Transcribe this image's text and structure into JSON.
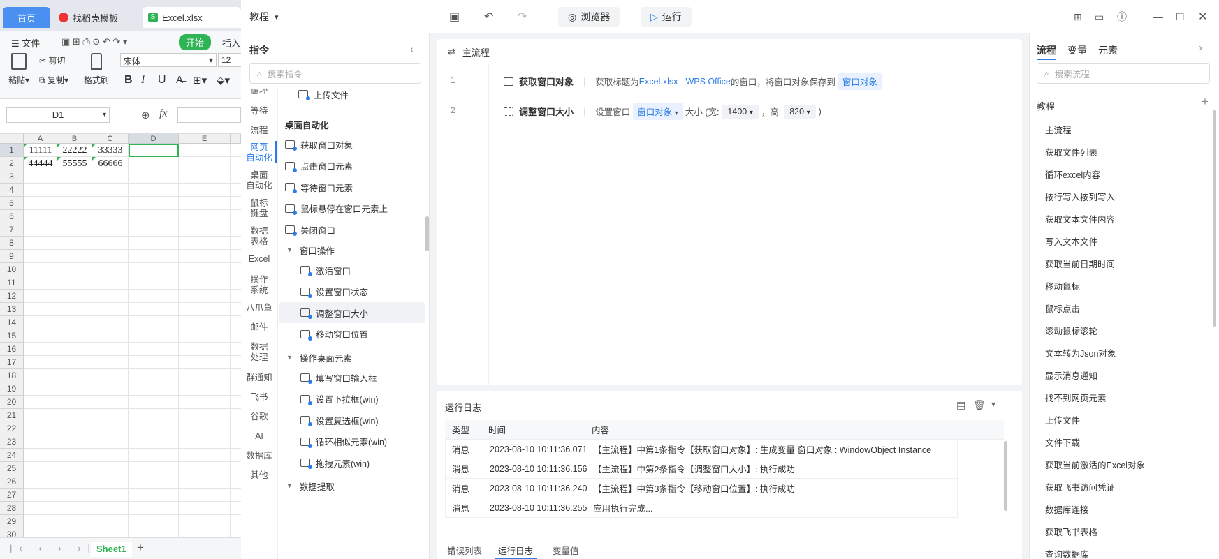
{
  "wps": {
    "tabs": {
      "home": "首页",
      "template": "找稻壳模板",
      "file": "Excel.xlsx"
    },
    "toolbar": {
      "file_menu": "文件",
      "start": "开始",
      "insert": "插入"
    },
    "ribbon": {
      "paste": "粘贴",
      "cut": "剪切",
      "copy": "复制",
      "format_painter": "格式刷",
      "font_name": "宋体",
      "font_size": "12"
    },
    "cell_ref": "D1",
    "fx": "fx",
    "columns": [
      "A",
      "B",
      "C",
      "D",
      "E"
    ],
    "rows": [
      "1",
      "2",
      "3",
      "4",
      "5",
      "6",
      "7",
      "8",
      "9",
      "10",
      "11",
      "12",
      "13",
      "14",
      "15",
      "16",
      "17",
      "18",
      "19",
      "20",
      "21",
      "22",
      "23",
      "24",
      "25",
      "26",
      "27",
      "28",
      "29",
      "30"
    ],
    "cells": [
      [
        "11111",
        "22222",
        "33333"
      ],
      [
        "44444",
        "55555",
        "66666"
      ]
    ],
    "sheet_tab": "Sheet1"
  },
  "app": {
    "project_title": "教程",
    "browser_label": "浏览器",
    "run_label": "运行",
    "cmd_panel": {
      "title": "指令",
      "search_placeholder": "搜索指令",
      "categories": [
        "循环",
        "等待",
        "流程",
        "网页自动化",
        "桌面自动化",
        "鼠标键盘",
        "数据表格",
        "Excel",
        "操作系统",
        "八爪鱼",
        "邮件",
        "数据处理",
        "群通知",
        "飞书",
        "谷歌",
        "AI",
        "数据库",
        "其他"
      ],
      "top_item": "上传文件",
      "section": "桌面自动化",
      "items": [
        "获取窗口对象",
        "点击窗口元素",
        "等待窗口元素",
        "鼠标悬停在窗口元素上",
        "关闭窗口"
      ],
      "group1": "窗口操作",
      "group1_items": [
        "激活窗口",
        "设置窗口状态",
        "调整窗口大小",
        "移动窗口位置"
      ],
      "group2": "操作桌面元素",
      "group2_items": [
        "填写窗口输入框",
        "设置下拉框(win)",
        "设置复选框(win)",
        "循环相似元素(win)",
        "拖拽元素(win)"
      ],
      "group3": "数据提取"
    },
    "main_tab": "主流程",
    "steps": [
      {
        "num": "1",
        "title": "获取窗口对象",
        "pre": "获取标题为",
        "link": "Excel.xlsx - WPS Office",
        "mid": "的窗口，将窗口对象保存到",
        "tag": "窗口对象"
      },
      {
        "num": "2",
        "title": "调整窗口大小",
        "pre": "设置窗口",
        "tag": "窗口对象",
        "size_label": "大小 (宽:",
        "width": "1400",
        "height_label": "，高:",
        "height": "820",
        "end": ")"
      }
    ],
    "log": {
      "title": "运行日志",
      "headers": [
        "类型",
        "时间",
        "内容"
      ],
      "rows": [
        {
          "type": "消息",
          "time": "2023-08-10 10:11:36.071",
          "content": "【主流程】中第1条指令【获取窗口对象】: 生成变量 窗口对象 : WindowObject Instance"
        },
        {
          "type": "消息",
          "time": "2023-08-10 10:11:36.156",
          "content": "【主流程】中第2条指令【调整窗口大小】: 执行成功"
        },
        {
          "type": "消息",
          "time": "2023-08-10 10:11:36.240",
          "content": "【主流程】中第3条指令【移动窗口位置】: 执行成功"
        },
        {
          "type": "消息",
          "time": "2023-08-10 10:11:36.255",
          "content": "应用执行完成..."
        }
      ],
      "bottom_tabs": [
        "错误列表",
        "运行日志",
        "变量值"
      ]
    },
    "right_panel": {
      "tabs": [
        "流程",
        "变量",
        "元素"
      ],
      "search_placeholder": "搜索流程",
      "group": "教程",
      "flows": [
        "主流程",
        "获取文件列表",
        "循环excel内容",
        "按行写入按列写入",
        "获取文本文件内容",
        "写入文本文件",
        "获取当前日期时间",
        "移动鼠标",
        "鼠标点击",
        "滚动鼠标滚轮",
        "文本转为Json对象",
        "显示消息通知",
        "找不到网页元素",
        "上传文件",
        "文件下载",
        "获取当前激活的Excel对象",
        "获取飞书访问凭证",
        "数据库连接",
        "获取飞书表格",
        "查询数据库"
      ]
    }
  },
  "colors": {
    "accent": "#2b7de9",
    "wps_green": "#2fb455",
    "wps_blue_tab": "#4a90f0"
  }
}
